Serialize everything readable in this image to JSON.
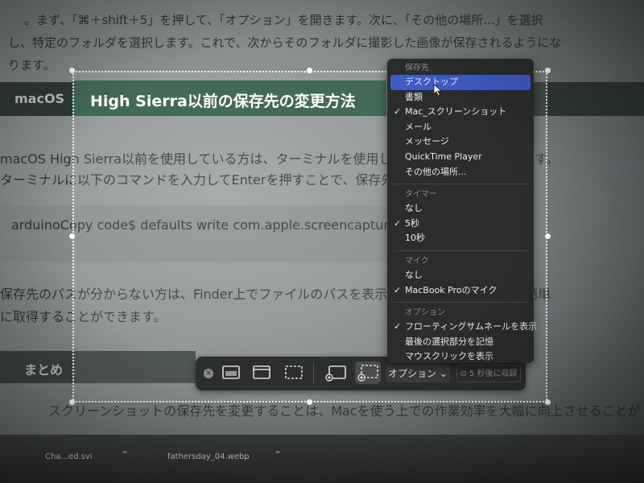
{
  "article": {
    "top_line_1": "。まず、「⌘＋shift＋5」を押して、「オプション」を開きます。次に、「その他の場所...」を選択",
    "top_line_2": "し、特定のフォルダを選択します。これで、次からそのフォルダに撮影した画像が保存されるようにな",
    "top_line_3": "ります。",
    "heading_prefix": "macOS",
    "heading": "High Sierra以前の保存先の変更方法",
    "para1_line1": "macOS High Sierra以前を使用している方は、ターミナルを使用して保存",
    "para1_line1_tail": "す。",
    "para1_line2": "ターミナルに以下のコマンドを入力してEnterを押すことで、保存先を変",
    "code": "arduinoCopy code$ defaults write com.apple.screencapture locat",
    "para2_line1": "保存先のパスが分からない方は、Finder上でファイルのパスを表示する",
    "para2_line1_tail": "簡単",
    "para2_line2": "に取得することができます。",
    "summary_heading": "まとめ",
    "bottom_line": "スクリーンショットの保存先を変更することは、Macを使う上での作業効率を大幅に向上させることが"
  },
  "menu": {
    "sections": [
      {
        "header": "保存先",
        "items": [
          {
            "label": "デスクトップ",
            "checked": false,
            "selected": true
          },
          {
            "label": "書類",
            "checked": false,
            "selected": false
          },
          {
            "label": "Mac_スクリーンショット",
            "checked": true,
            "selected": false
          },
          {
            "label": "メール",
            "checked": false,
            "selected": false
          },
          {
            "label": "メッセージ",
            "checked": false,
            "selected": false
          },
          {
            "label": "QuickTime Player",
            "checked": false,
            "selected": false
          },
          {
            "label": "その他の場所...",
            "checked": false,
            "selected": false
          }
        ]
      },
      {
        "header": "タイマー",
        "items": [
          {
            "label": "なし",
            "checked": false,
            "selected": false
          },
          {
            "label": "5秒",
            "checked": true,
            "selected": false
          },
          {
            "label": "10秒",
            "checked": false,
            "selected": false
          }
        ]
      },
      {
        "header": "マイク",
        "items": [
          {
            "label": "なし",
            "checked": false,
            "selected": false
          },
          {
            "label": "MacBook Proのマイク",
            "checked": true,
            "selected": false
          }
        ]
      },
      {
        "header": "オプション",
        "items": [
          {
            "label": "フローティングサムネールを表示",
            "checked": true,
            "selected": false
          },
          {
            "label": "最後の選択部分を記憶",
            "checked": false,
            "selected": false
          },
          {
            "label": "マウスクリックを表示",
            "checked": false,
            "selected": false
          }
        ]
      }
    ]
  },
  "toolbar": {
    "options_label": "オプション ⌄",
    "capture_label": "⊙ 5 秒後に収録"
  },
  "downloads": {
    "item1": "Cha...ed.svi",
    "item2": "fathersday_04.webp"
  },
  "icons": {
    "check": "✓",
    "close": "×",
    "chevron": "⌃"
  },
  "colors": {
    "menu_bg": "#2a2c2e",
    "selected": "#3f5bc4",
    "heading_green": "#2e5a45"
  }
}
